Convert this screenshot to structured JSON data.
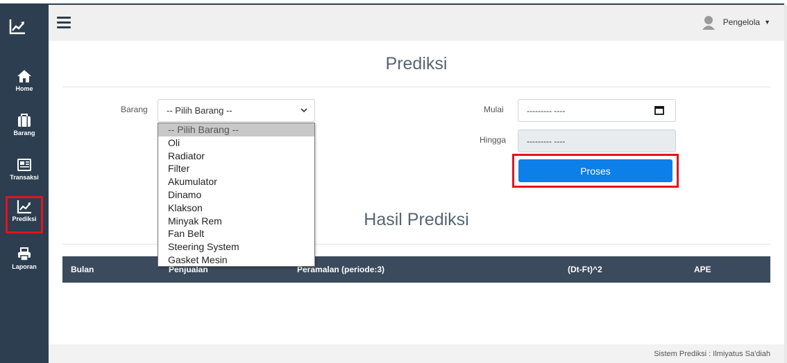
{
  "header": {
    "user_name": "Pengelola"
  },
  "sidebar": {
    "items": [
      {
        "label": "Home",
        "icon": "home-icon"
      },
      {
        "label": "Barang",
        "icon": "briefcase-icon"
      },
      {
        "label": "Transaksi",
        "icon": "newspaper-icon"
      },
      {
        "label": "Prediksi",
        "icon": "chart-line-icon",
        "active": true
      },
      {
        "label": "Laporan",
        "icon": "printer-icon"
      }
    ]
  },
  "main": {
    "title": "Prediksi",
    "barang_label": "Barang",
    "barang_selected": "-- Pilih Barang --",
    "barang_options": [
      "-- Pilih Barang --",
      "Oli",
      "Radiator",
      "Filter",
      "Akumulator",
      "Dinamo",
      "Klakson",
      "Minyak Rem",
      "Fan Belt",
      "Steering System",
      "Gasket Mesin"
    ],
    "mulai_label": "Mulai",
    "mulai_value": "--------- ----",
    "hingga_label": "Hingga",
    "hingga_value": "--------- ----",
    "proses_label": "Proses",
    "result_title": "Hasil Prediksi",
    "table_headers": [
      "Bulan",
      "Penjualan",
      "Peramalan (periode:3)",
      "(Dt-Ft)^2",
      "APE"
    ]
  },
  "footer": {
    "text": "Sistem Prediksi : Ilmiyatus Sa'diah"
  },
  "colors": {
    "sidebar": "#2c3e50",
    "button": "#0d7fe8",
    "highlight": "#e0141e",
    "table_header": "#3b4a5c"
  }
}
